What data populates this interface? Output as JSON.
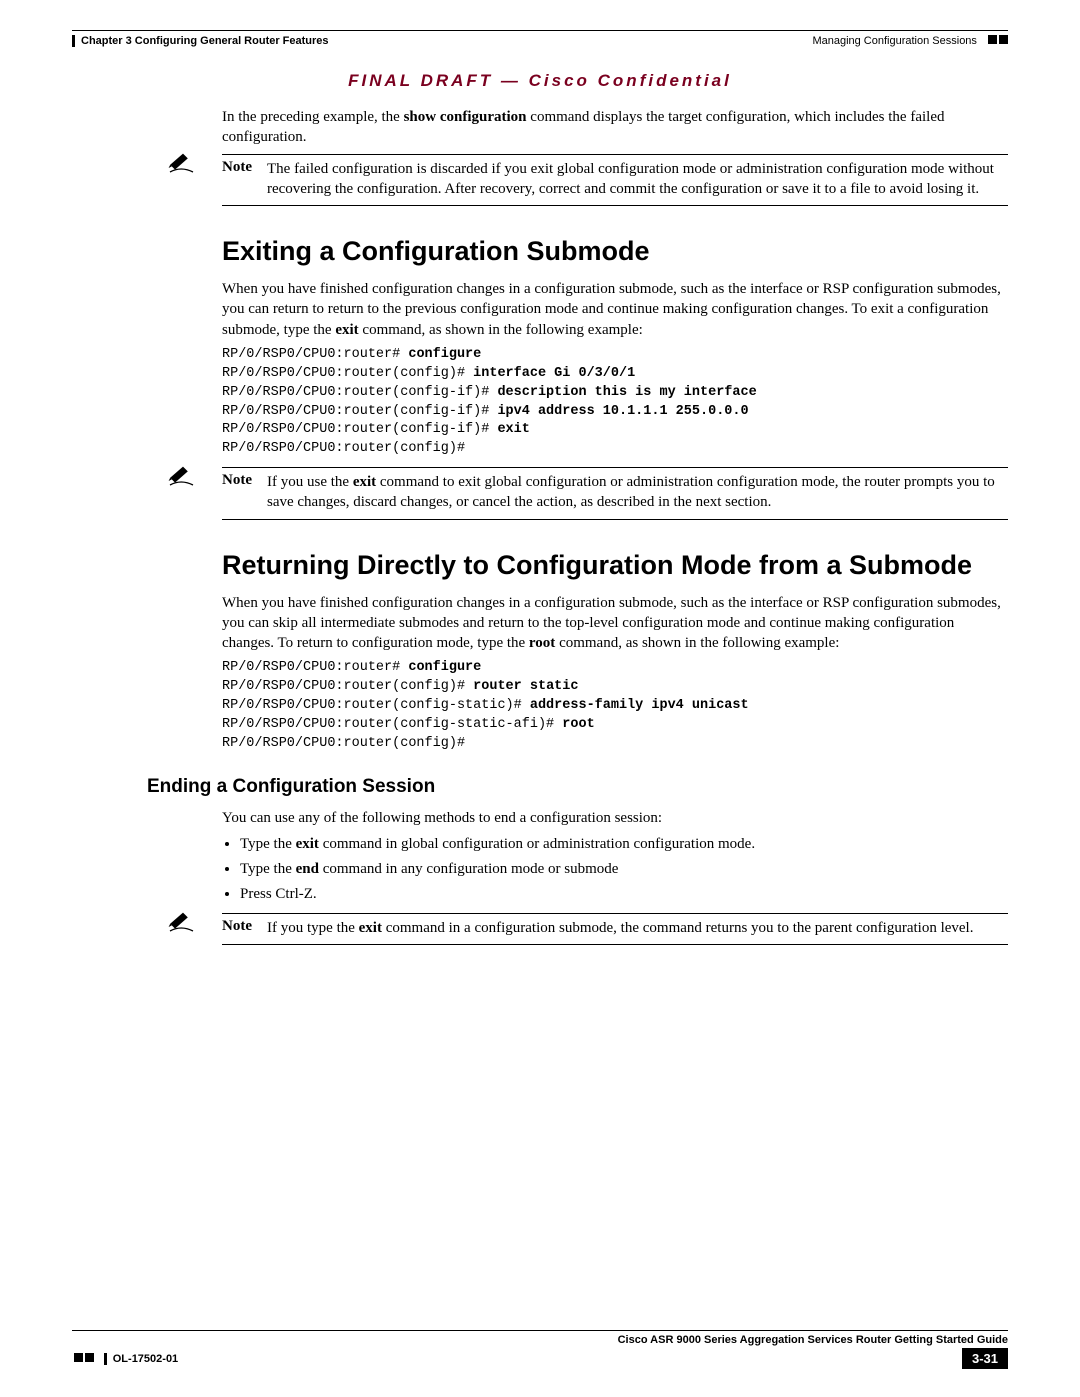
{
  "header": {
    "chapter": "Chapter 3    Configuring General Router Features",
    "section_right": "Managing Configuration Sessions"
  },
  "final_draft": "FINAL DRAFT — Cisco Confidential",
  "intro": {
    "p1_a": "In the preceding example, the ",
    "p1_b": "show configuration",
    "p1_c": " command displays the target configuration, which includes the failed configuration."
  },
  "note1": {
    "label": "Note",
    "text": "The failed configuration is discarded if you exit global configuration mode or administration configuration mode without recovering the configuration. After recovery, correct and commit the configuration or save it to a file to avoid losing it."
  },
  "h1a": "Exiting a Configuration Submode",
  "sub1": {
    "p1_a": "When you have finished configuration changes in a configuration submode, such as the interface or RSP configuration submodes, you can return to return to the previous configuration mode and continue making configuration changes. To exit a configuration submode, type the ",
    "p1_b": "exit",
    "p1_c": " command, as shown in the following example:",
    "code": {
      "l1p": "RP/0/RSP0/CPU0:router# ",
      "l1b": "configure",
      "l2p": "RP/0/RSP0/CPU0:router(config)# ",
      "l2b": "interface Gi 0/3/0/1",
      "l3p": "RP/0/RSP0/CPU0:router(config-if)# ",
      "l3b": "description this is my interface",
      "l4p": "RP/0/RSP0/CPU0:router(config-if)# ",
      "l4b": "ipv4 address 10.1.1.1 255.0.0.0",
      "l5p": "RP/0/RSP0/CPU0:router(config-if)# ",
      "l5b": "exit",
      "l6p": "RP/0/RSP0/CPU0:router(config)# "
    }
  },
  "note2": {
    "label": "Note",
    "t1": "If you use the ",
    "t2": "exit",
    "t3": " command to exit global configuration or administration configuration mode, the router prompts you to save changes, discard changes, or cancel the action, as described in the next section."
  },
  "h1b": "Returning Directly to Configuration Mode from a Submode",
  "sub2": {
    "p1_a": "When you have finished configuration changes in a configuration submode, such as the interface or RSP configuration submodes, you can skip all intermediate submodes and return to the top-level configuration mode and continue making configuration changes. To return to configuration mode, type the ",
    "p1_b": "root",
    "p1_c": " command, as shown in the following example:",
    "code": {
      "l1p": "RP/0/RSP0/CPU0:router# ",
      "l1b": "configure",
      "l2p": "RP/0/RSP0/CPU0:router(config)# ",
      "l2b": "router static",
      "l3p": "RP/0/RSP0/CPU0:router(config-static)# ",
      "l3b": "address-family ipv4 unicast",
      "l4p": "RP/0/RSP0/CPU0:router(config-static-afi)# ",
      "l4b": "root",
      "l5p": "RP/0/RSP0/CPU0:router(config)# "
    }
  },
  "h2a": "Ending a Configuration Session",
  "sub3": {
    "p1": "You can use any of the following methods to end a configuration session:",
    "b1a": "Type the ",
    "b1b": "exit",
    "b1c": " command in global configuration or administration configuration mode.",
    "b2a": "Type the ",
    "b2b": "end",
    "b2c": " command in any configuration mode or submode",
    "b3": "Press Ctrl-Z."
  },
  "note3": {
    "label": "Note",
    "t1": "If you type the ",
    "t2": "exit",
    "t3": " command in a configuration submode, the command returns you to the parent configuration level."
  },
  "footer": {
    "guide": "Cisco ASR 9000 Series Aggregation Services Router Getting Started Guide",
    "docid": "OL-17502-01",
    "pagenum": "3-31"
  }
}
